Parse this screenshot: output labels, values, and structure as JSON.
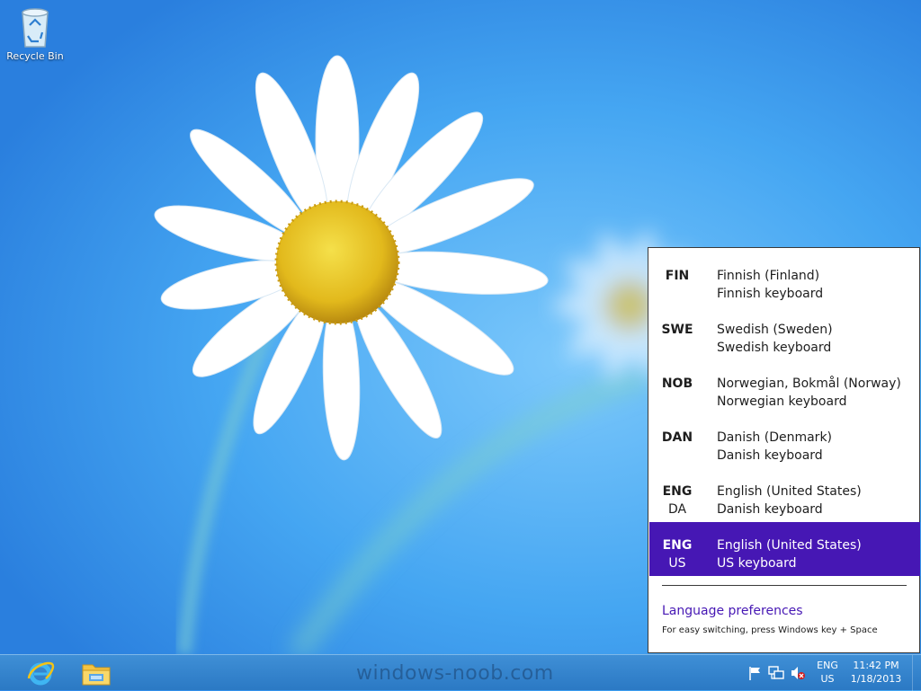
{
  "desktop": {
    "icons": [
      {
        "label": "Recycle Bin",
        "icon": "recycle-bin-icon"
      }
    ]
  },
  "language_flyout": {
    "items": [
      {
        "code": "FIN",
        "sub": "",
        "language": "Finnish (Finland)",
        "keyboard": "Finnish keyboard",
        "selected": false
      },
      {
        "code": "SWE",
        "sub": "",
        "language": "Swedish (Sweden)",
        "keyboard": "Swedish keyboard",
        "selected": false
      },
      {
        "code": "NOB",
        "sub": "",
        "language": "Norwegian, Bokmål (Norway)",
        "keyboard": "Norwegian keyboard",
        "selected": false
      },
      {
        "code": "DAN",
        "sub": "",
        "language": "Danish (Denmark)",
        "keyboard": "Danish keyboard",
        "selected": false
      },
      {
        "code": "ENG",
        "sub": "DA",
        "language": "English (United States)",
        "keyboard": "Danish keyboard",
        "selected": false
      },
      {
        "code": "ENG",
        "sub": "US",
        "language": "English (United States)",
        "keyboard": "US keyboard",
        "selected": true
      }
    ],
    "preferences_link": "Language preferences",
    "hint": "For easy switching, press Windows key + Space",
    "colors": {
      "selected_bg": "#4617b4",
      "link": "#4617b4"
    }
  },
  "taskbar": {
    "apps": [
      {
        "name": "Internet Explorer",
        "icon": "internet-explorer-icon"
      },
      {
        "name": "File Explorer",
        "icon": "file-explorer-icon"
      }
    ],
    "watermark": "windows-noob.com",
    "tray": {
      "icons": [
        "action-center-flag-icon",
        "network-icon",
        "volume-muted-icon"
      ],
      "language_code": "ENG",
      "keyboard_code": "US",
      "time": "11:42 PM",
      "date": "1/18/2013"
    },
    "colors": {
      "background": "#2b79c4"
    }
  }
}
